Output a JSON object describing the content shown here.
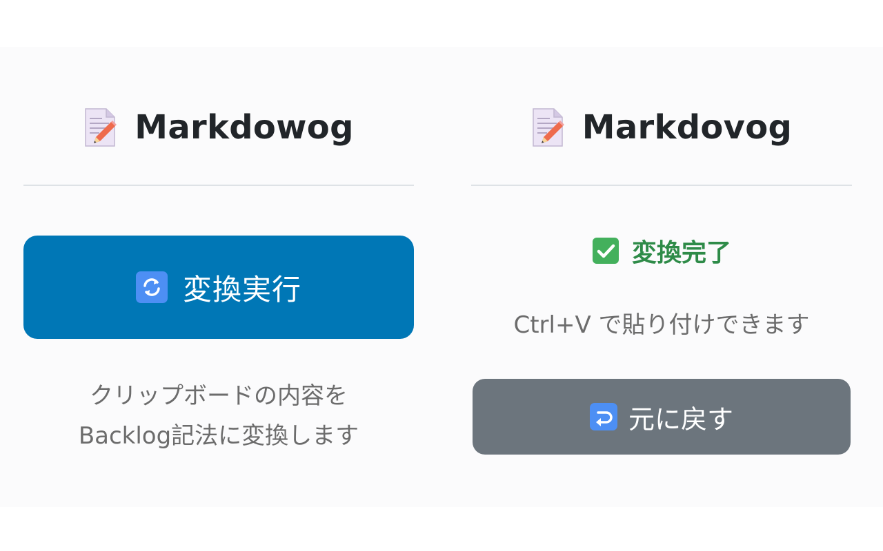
{
  "colors": {
    "primary_button": "#0077b6",
    "secondary_button": "#6c757d",
    "success_text": "#2e8b48",
    "title_text": "#212529",
    "muted_text": "#6c6c6c",
    "divider": "#dee2e6"
  },
  "left_panel": {
    "header": {
      "icon": "memo-icon",
      "title": "Markdowog"
    },
    "convert_button": {
      "icon": "refresh-icon",
      "label": "変換実行"
    },
    "description_lines": [
      "クリップボードの内容を",
      "Backlog記法に変換します"
    ]
  },
  "right_panel": {
    "header": {
      "icon": "memo-icon",
      "title": "Markdovog"
    },
    "status": {
      "icon": "check-icon",
      "text": "変換完了"
    },
    "hint": "Ctrl+V で貼り付けできます",
    "undo_button": {
      "icon": "return-icon",
      "label": "元に戻す"
    }
  }
}
